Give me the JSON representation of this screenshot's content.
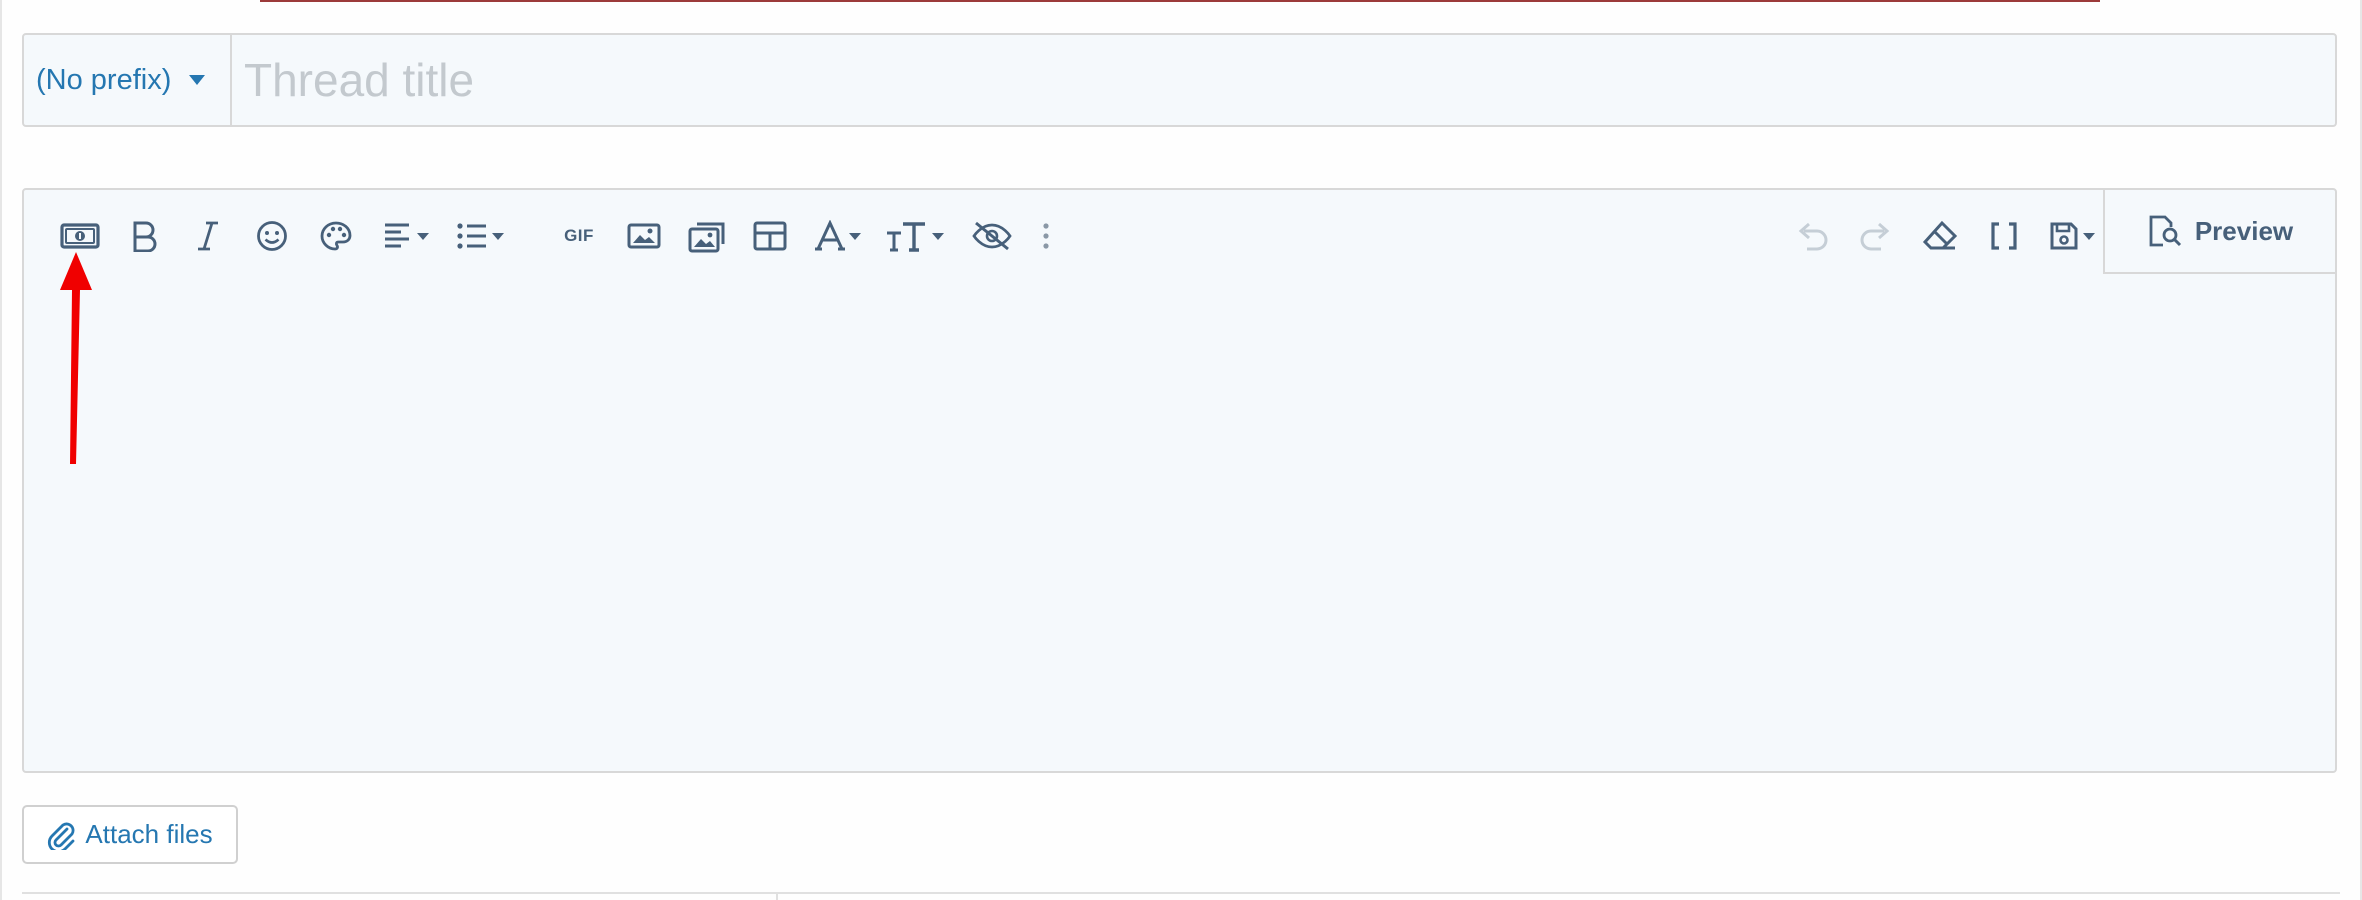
{
  "form": {
    "prefix_label": "(No prefix)",
    "title_placeholder": "Thread title",
    "title_value": ""
  },
  "toolbar": {
    "left_tools": [
      {
        "name": "money-icon",
        "tooltip": ""
      },
      {
        "name": "bold-icon"
      },
      {
        "name": "italic-icon"
      },
      {
        "name": "smile-icon"
      },
      {
        "name": "palette-icon"
      },
      {
        "name": "align-left-icon",
        "has_dropdown": true
      },
      {
        "name": "list-icon",
        "has_dropdown": true
      },
      {
        "name": "gif-icon"
      },
      {
        "name": "image-icon"
      },
      {
        "name": "media-gallery-icon"
      },
      {
        "name": "table-icon"
      },
      {
        "name": "font-family-icon",
        "has_dropdown": true
      },
      {
        "name": "font-size-icon",
        "has_dropdown": true
      },
      {
        "name": "hidden-eye-icon"
      },
      {
        "name": "more-vertical-icon"
      }
    ],
    "gif_label": "GIF",
    "right_tools": [
      {
        "name": "undo-icon",
        "disabled": true
      },
      {
        "name": "redo-icon",
        "disabled": true
      },
      {
        "name": "eraser-icon"
      },
      {
        "name": "brackets-icon"
      },
      {
        "name": "save-draft-icon",
        "has_dropdown": true
      }
    ],
    "preview_label": "Preview"
  },
  "editor": {
    "content": ""
  },
  "attach": {
    "label": "Attach files"
  },
  "colors": {
    "link_blue": "#2577b1",
    "icon_slate": "#47607a",
    "icon_disabled": "#c5ced6",
    "annotation_red": "#f00000",
    "panel_bg": "#f5f9fc",
    "border": "#d8d8d8"
  }
}
